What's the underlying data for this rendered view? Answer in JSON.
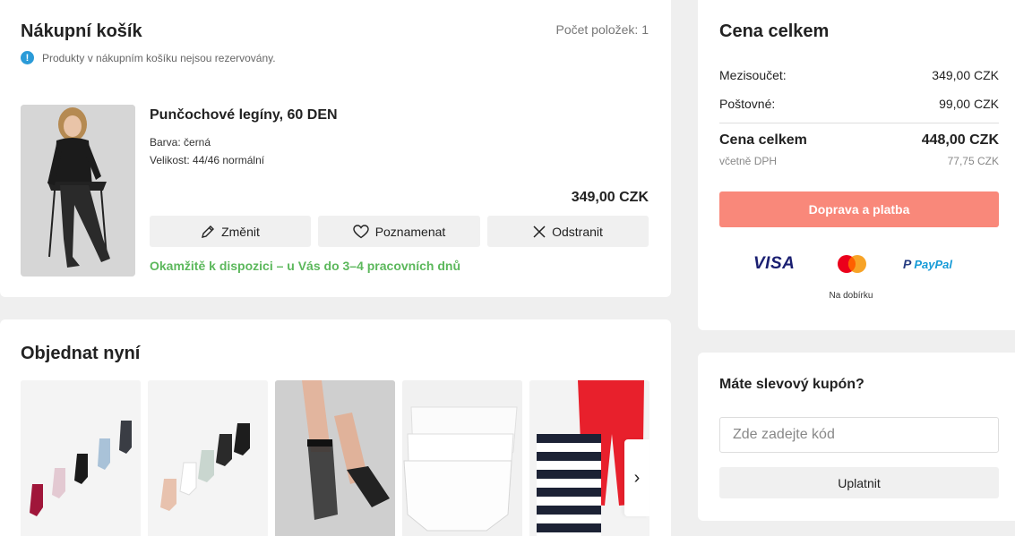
{
  "cart": {
    "title": "Nákupní košík",
    "count_label": "Počet položek: 1",
    "info_icon": "info-icon",
    "info_text": "Produkty v nákupním košíku nejsou rezervovány.",
    "item": {
      "name": "Punčochové legíny, 60 DEN",
      "color": "Barva: černá",
      "size": "Velikost: 44/46 normální",
      "price": "349,00 CZK",
      "availability": "Okamžitě k dispozici – u Vás do 3–4 pracovních dnů",
      "actions": [
        {
          "label": "Změnit",
          "icon": "pencil-icon"
        },
        {
          "label": "Poznamenat",
          "icon": "heart-icon"
        },
        {
          "label": "Odstranit",
          "icon": "close-icon"
        }
      ]
    }
  },
  "order_now": {
    "title": "Objednat nyní"
  },
  "summary": {
    "title": "Cena celkem",
    "subtotal_label": "Mezisoučet:",
    "subtotal_value": "349,00 CZK",
    "shipping_label": "Poštovné:",
    "shipping_value": "99,00 CZK",
    "total_label": "Cena celkem",
    "total_value": "448,00 CZK",
    "vat_label": "včetně DPH",
    "vat_value": "77,75 CZK",
    "checkout_label": "Doprava a platba",
    "payment_visa": "VISA",
    "payment_paypal": "PayPal",
    "cod_label": "Na dobírku",
    "accent_color": "#f9887a"
  },
  "coupon": {
    "title": "Máte slevový kupón?",
    "placeholder": "Zde zadejte kód",
    "apply_label": "Uplatnit"
  }
}
